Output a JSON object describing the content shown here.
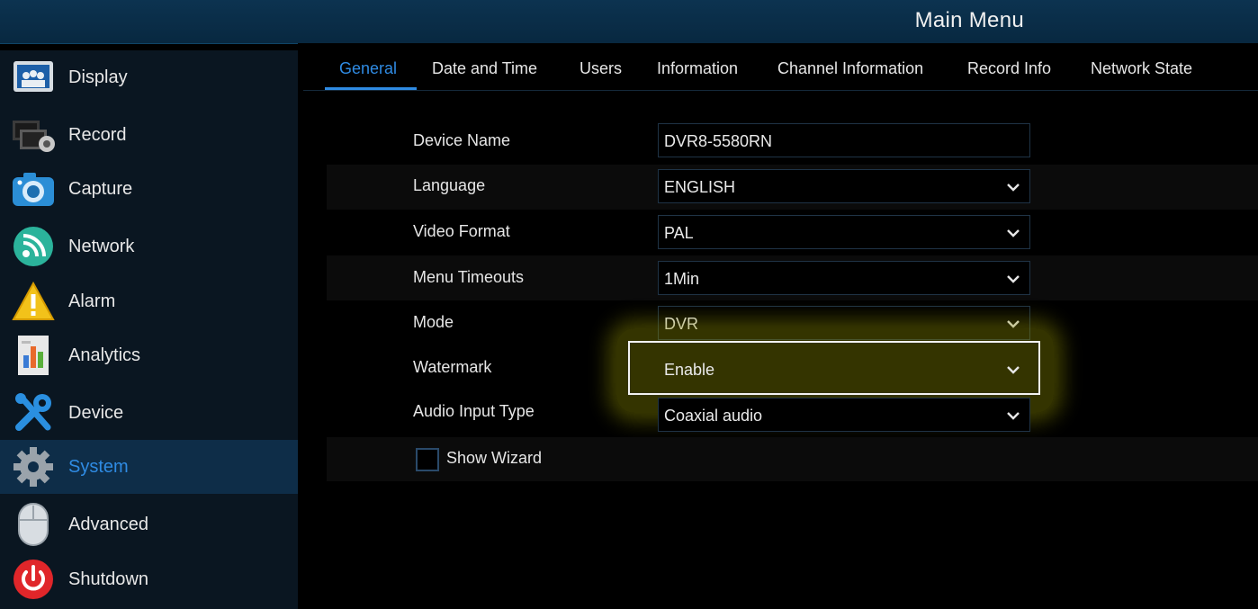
{
  "window": {
    "title": "Main Menu"
  },
  "sidebar": {
    "items": [
      {
        "label": "Display",
        "icon": "display-icon"
      },
      {
        "label": "Record",
        "icon": "record-icon"
      },
      {
        "label": "Capture",
        "icon": "camera-icon"
      },
      {
        "label": "Network",
        "icon": "network-icon"
      },
      {
        "label": "Alarm",
        "icon": "alarm-warning-icon"
      },
      {
        "label": "Analytics",
        "icon": "analytics-chart-icon"
      },
      {
        "label": "Device",
        "icon": "tools-icon"
      },
      {
        "label": "System",
        "icon": "gear-icon",
        "active": true
      },
      {
        "label": "Advanced",
        "icon": "mouse-icon"
      },
      {
        "label": "Shutdown",
        "icon": "power-icon"
      }
    ]
  },
  "tabs": [
    {
      "label": "General",
      "active": true
    },
    {
      "label": "Date and Time"
    },
    {
      "label": "Users"
    },
    {
      "label": "Information"
    },
    {
      "label": "Channel Information"
    },
    {
      "label": "Record Info"
    },
    {
      "label": "Network State"
    }
  ],
  "form": {
    "device_name": {
      "label": "Device Name",
      "value": "DVR8-5580RN"
    },
    "language": {
      "label": "Language",
      "value": "ENGLISH"
    },
    "video_format": {
      "label": "Video Format",
      "value": "PAL"
    },
    "menu_timeouts": {
      "label": "Menu Timeouts",
      "value": "1Min"
    },
    "mode": {
      "label": "Mode",
      "value": "DVR"
    },
    "watermark": {
      "label": "Watermark",
      "value": "Enable"
    },
    "audio_input_type": {
      "label": "Audio Input Type",
      "value": "Coaxial audio"
    },
    "show_wizard": {
      "label": "Show Wizard",
      "checked": false
    }
  },
  "colors": {
    "accent": "#2f8be3",
    "highlight": "#8c8c00",
    "sidebar_active": "#0e2d48"
  }
}
